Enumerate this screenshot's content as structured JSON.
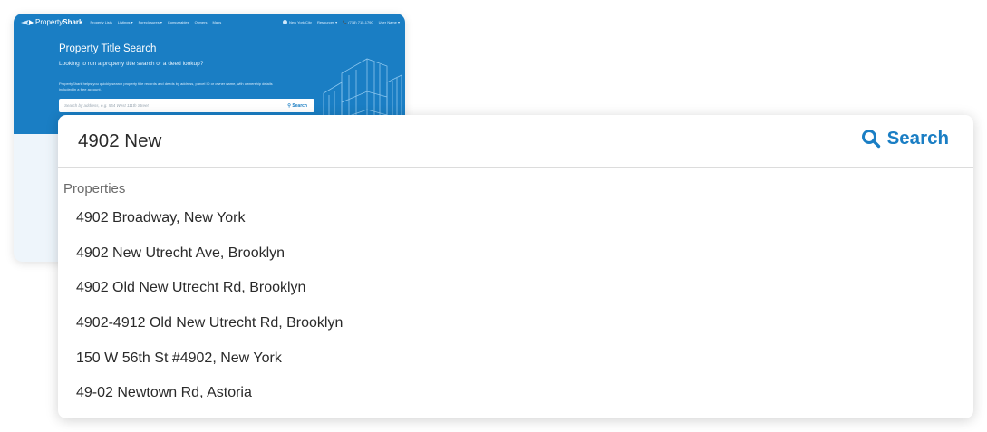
{
  "background_page": {
    "logo": {
      "prefix": "Property",
      "bold": "Shark"
    },
    "nav_left": [
      "Property Lists",
      "Listings ▾",
      "Foreclosures ▾",
      "Comparables",
      "Owners",
      "Maps"
    ],
    "nav_right": {
      "city": "New York City",
      "resources": "Resources ▾",
      "phone": "📞 (718) 715-1790",
      "user": "User Name ▾"
    },
    "hero_title": "Property Title Search",
    "hero_subtitle": "Looking to run a property title search or a deed lookup?",
    "hero_description": "PropertyShark helps you quickly search property title records and deeds by address, parcel ID or owner name, with ownership details included in a free account.",
    "search_placeholder": "Search by address, e.g. 554 West 111th Street",
    "search_button": "Search"
  },
  "search": {
    "value": "4902 New",
    "button_label": "Search"
  },
  "dropdown": {
    "section_label": "Properties",
    "results": [
      "4902 Broadway, New York",
      "4902 New Utrecht Ave, Brooklyn",
      "4902 Old New Utrecht Rd, Brooklyn",
      "4902-4912 Old New Utrecht Rd, Brooklyn",
      "150 W 56th St #4902, New York",
      "49-02 Newtown Rd, Astoria"
    ]
  },
  "colors": {
    "brand": "#1a7ec4",
    "text": "#2a2a2a",
    "muted": "#6b6b6b"
  }
}
